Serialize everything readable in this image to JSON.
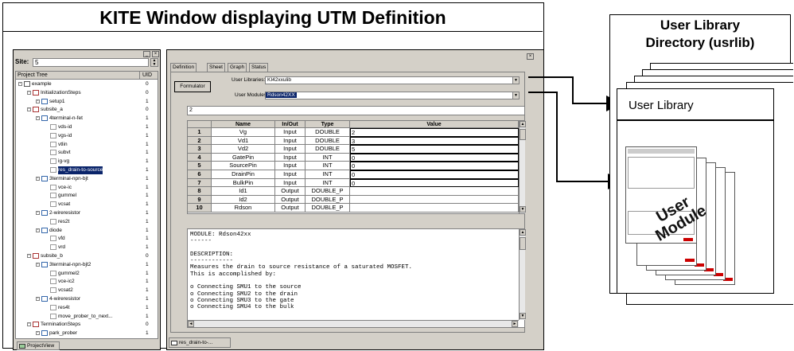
{
  "main_title": "KITE Window displaying UTM Definition",
  "library_box_title": [
    "User Library",
    "Directory (usrlib)"
  ],
  "user_library_card_label": "User Library",
  "user_module_watermark": [
    "User",
    "Module"
  ],
  "site": {
    "label": "Site:",
    "value": "5"
  },
  "project_tree": {
    "header_name": "Project Tree",
    "header_uid": "UID",
    "rows": [
      {
        "label": "example",
        "uid": "0",
        "depth": 0
      },
      {
        "label": "InitializationSteps",
        "uid": "0",
        "depth": 1
      },
      {
        "label": "setup1",
        "uid": "1",
        "depth": 2
      },
      {
        "label": "subsite_a",
        "uid": "0",
        "depth": 1
      },
      {
        "label": "4terminal-n-fet",
        "uid": "1",
        "depth": 2
      },
      {
        "label": "vds-id",
        "uid": "1",
        "depth": 3
      },
      {
        "label": "vgs-id",
        "uid": "1",
        "depth": 3
      },
      {
        "label": "vtlin",
        "uid": "1",
        "depth": 3
      },
      {
        "label": "subvt",
        "uid": "1",
        "depth": 3
      },
      {
        "label": "ig-vg",
        "uid": "1",
        "depth": 3
      },
      {
        "label": "res_drain-to-source",
        "uid": "1",
        "depth": 3,
        "selected": true
      },
      {
        "label": "3terminal-npn-bjt",
        "uid": "1",
        "depth": 2
      },
      {
        "label": "vce-ic",
        "uid": "1",
        "depth": 3
      },
      {
        "label": "gummel",
        "uid": "1",
        "depth": 3
      },
      {
        "label": "vcsat",
        "uid": "1",
        "depth": 3
      },
      {
        "label": "2-wireresistor",
        "uid": "1",
        "depth": 2
      },
      {
        "label": "res2t",
        "uid": "1",
        "depth": 3
      },
      {
        "label": "diode",
        "uid": "1",
        "depth": 2
      },
      {
        "label": "vfd",
        "uid": "1",
        "depth": 3
      },
      {
        "label": "vrd",
        "uid": "1",
        "depth": 3
      },
      {
        "label": "subsite_b",
        "uid": "0",
        "depth": 1
      },
      {
        "label": "3terminal-npn-bjt2",
        "uid": "1",
        "depth": 2
      },
      {
        "label": "gummel2",
        "uid": "1",
        "depth": 3
      },
      {
        "label": "vce-ic2",
        "uid": "1",
        "depth": 3
      },
      {
        "label": "vcsat2",
        "uid": "1",
        "depth": 3
      },
      {
        "label": "4-wireresistor",
        "uid": "1",
        "depth": 2
      },
      {
        "label": "res4t",
        "uid": "1",
        "depth": 3
      },
      {
        "label": "move_prober_to_next...",
        "uid": "1",
        "depth": 3
      },
      {
        "label": "TerminationSteps",
        "uid": "0",
        "depth": 1
      },
      {
        "label": "park_prober",
        "uid": "1",
        "depth": 2
      }
    ],
    "bottom_tab": "ProjectView"
  },
  "definition": {
    "tabs": [
      "Definition",
      "Sheet",
      "Graph",
      "Status"
    ],
    "formulator_label": "Formulator",
    "user_libraries_label": "User Libraries:",
    "user_libraries_value": "KI42xxulib",
    "user_modules_label": "User Modules:",
    "user_modules_value": "Rdson42XX",
    "edit_value": "2",
    "grid_headers": [
      "Name",
      "In/Out",
      "Type",
      "Value"
    ],
    "grid_rows": [
      {
        "n": "1",
        "name": "Vg",
        "io": "Input",
        "type": "DOUBLE",
        "value": "2"
      },
      {
        "n": "2",
        "name": "Vd1",
        "io": "Input",
        "type": "DOUBLE",
        "value": "3"
      },
      {
        "n": "3",
        "name": "Vd2",
        "io": "Input",
        "type": "DOUBLE",
        "value": "5"
      },
      {
        "n": "4",
        "name": "GatePin",
        "io": "Input",
        "type": "INT",
        "value": "0"
      },
      {
        "n": "5",
        "name": "SourcePin",
        "io": "Input",
        "type": "INT",
        "value": "0"
      },
      {
        "n": "6",
        "name": "DrainPin",
        "io": "Input",
        "type": "INT",
        "value": "0"
      },
      {
        "n": "7",
        "name": "BulkPin",
        "io": "Input",
        "type": "INT",
        "value": "0"
      },
      {
        "n": "8",
        "name": "Id1",
        "io": "Output",
        "type": "DOUBLE_P",
        "value": ""
      },
      {
        "n": "9",
        "name": "Id2",
        "io": "Output",
        "type": "DOUBLE_P",
        "value": ""
      },
      {
        "n": "10",
        "name": "Rdson",
        "io": "Output",
        "type": "DOUBLE_P",
        "value": ""
      }
    ],
    "description_lines": [
      "MODULE: Rdson42xx",
      "------",
      "",
      "DESCRIPTION:",
      "------------",
      "Measures the drain to source resistance of a saturated MOSFET.",
      "This is accomplished by:",
      "",
      "o Connecting SMU1 to the source",
      "o Connecting SMU2 to the drain",
      "o Connecting SMU3 to the gate",
      "o Connecting SMU4 to the bulk"
    ],
    "bottom_tab": "res_drain-to-..."
  },
  "colors": {
    "selection": "#0a246a",
    "window_face": "#d4d0c8",
    "thumb_accent": "#cc0000"
  }
}
